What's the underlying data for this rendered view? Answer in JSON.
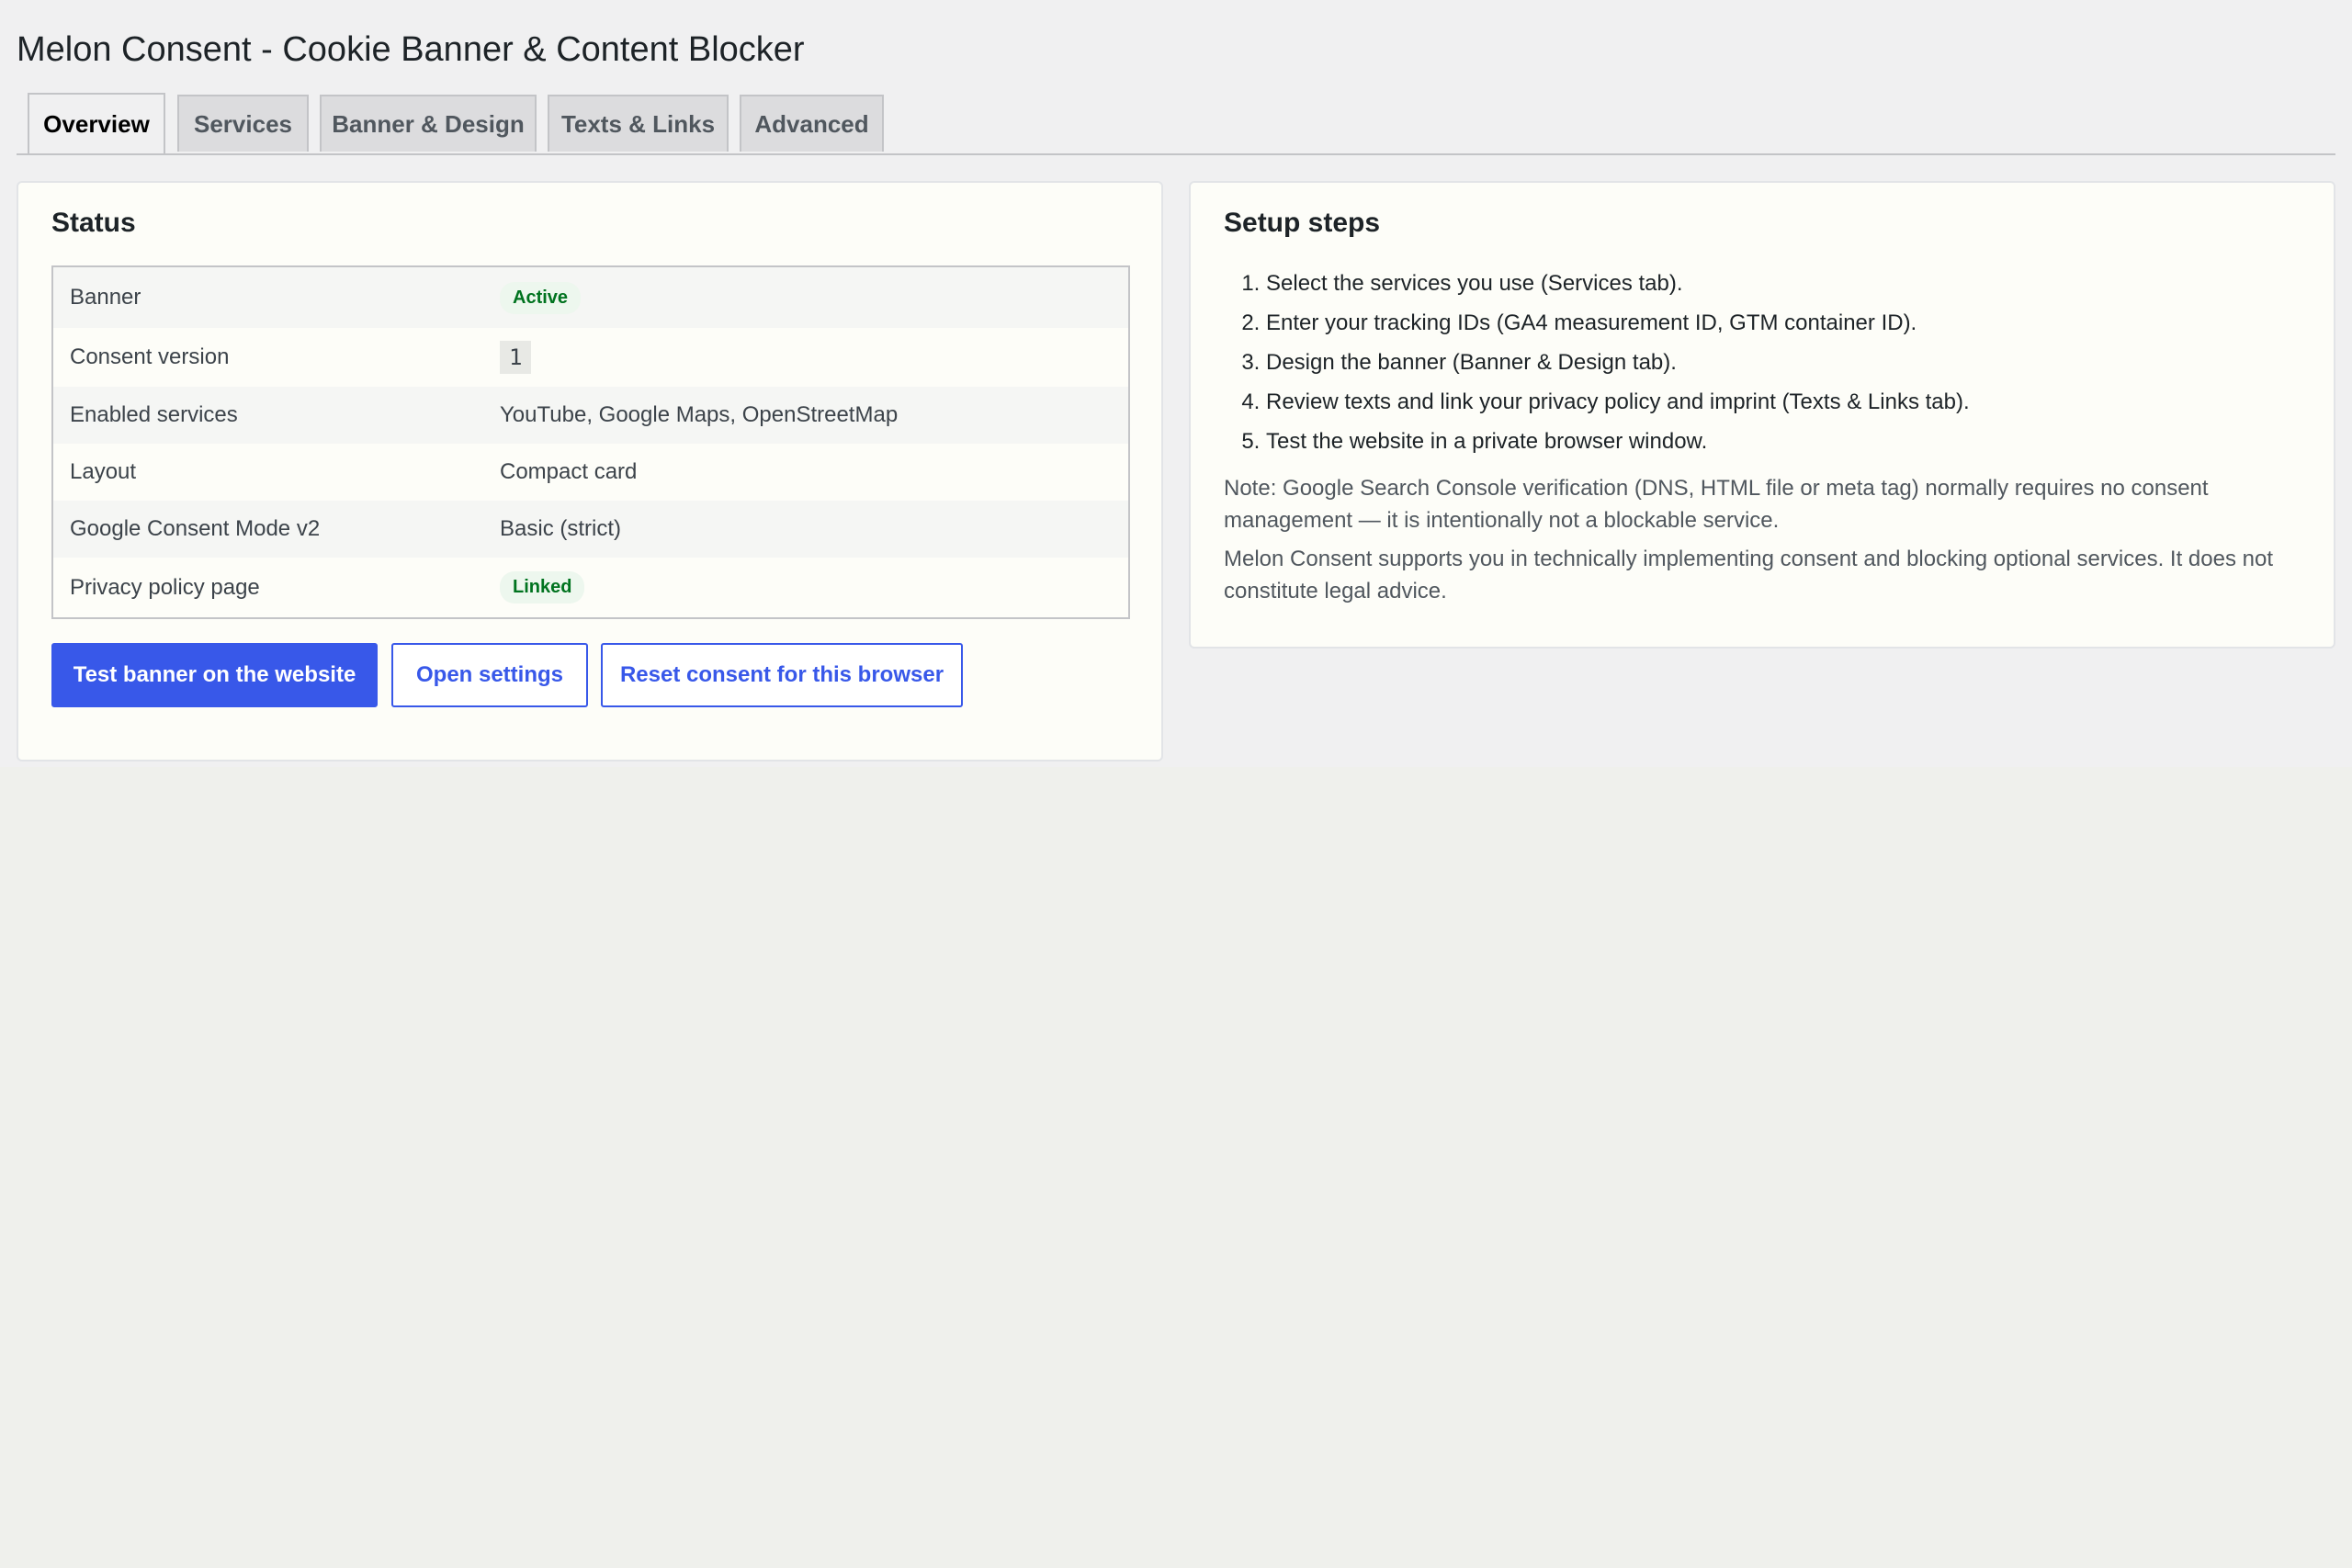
{
  "page": {
    "title": "Melon Consent - Cookie Banner & Content Blocker"
  },
  "tabs": [
    {
      "label": "Overview",
      "active": true
    },
    {
      "label": "Services",
      "active": false
    },
    {
      "label": "Banner & Design",
      "active": false
    },
    {
      "label": "Texts & Links",
      "active": false
    },
    {
      "label": "Advanced",
      "active": false
    }
  ],
  "status": {
    "heading": "Status",
    "rows": [
      {
        "label": "Banner",
        "value": "Active"
      },
      {
        "label": "Consent version",
        "value": "1"
      },
      {
        "label": "Enabled services",
        "value": "YouTube, Google Maps, OpenStreetMap"
      },
      {
        "label": "Layout",
        "value": "Compact card"
      },
      {
        "label": "Google Consent Mode v2",
        "value": "Basic (strict)"
      },
      {
        "label": "Privacy policy page",
        "value": "Linked"
      }
    ],
    "buttons": {
      "test_banner": "Test banner on the website",
      "open_settings": "Open settings",
      "reset_consent": "Reset consent for this browser"
    }
  },
  "setup": {
    "heading": "Setup steps",
    "steps": [
      "Select the services you use (Services tab).",
      "Enter your tracking IDs (GA4 measurement ID, GTM container ID).",
      "Design the banner (Banner & Design tab).",
      "Review texts and link your privacy policy and imprint (Texts & Links tab).",
      "Test the website in a private browser window."
    ],
    "note_search_console": "Note: Google Search Console verification (DNS, HTML file or meta tag) normally requires no consent management — it is intentionally not a blockable service.",
    "note_legal": "Melon Consent supports you in technically implementing consent and blocking optional services. It does not constitute legal advice."
  },
  "colors": {
    "accent": "#3858e9",
    "badge_text": "#00731f",
    "badge_bg": "#edf7ee",
    "page_bg": "#f0f0f1",
    "card_bg": "#fdfdf8"
  }
}
